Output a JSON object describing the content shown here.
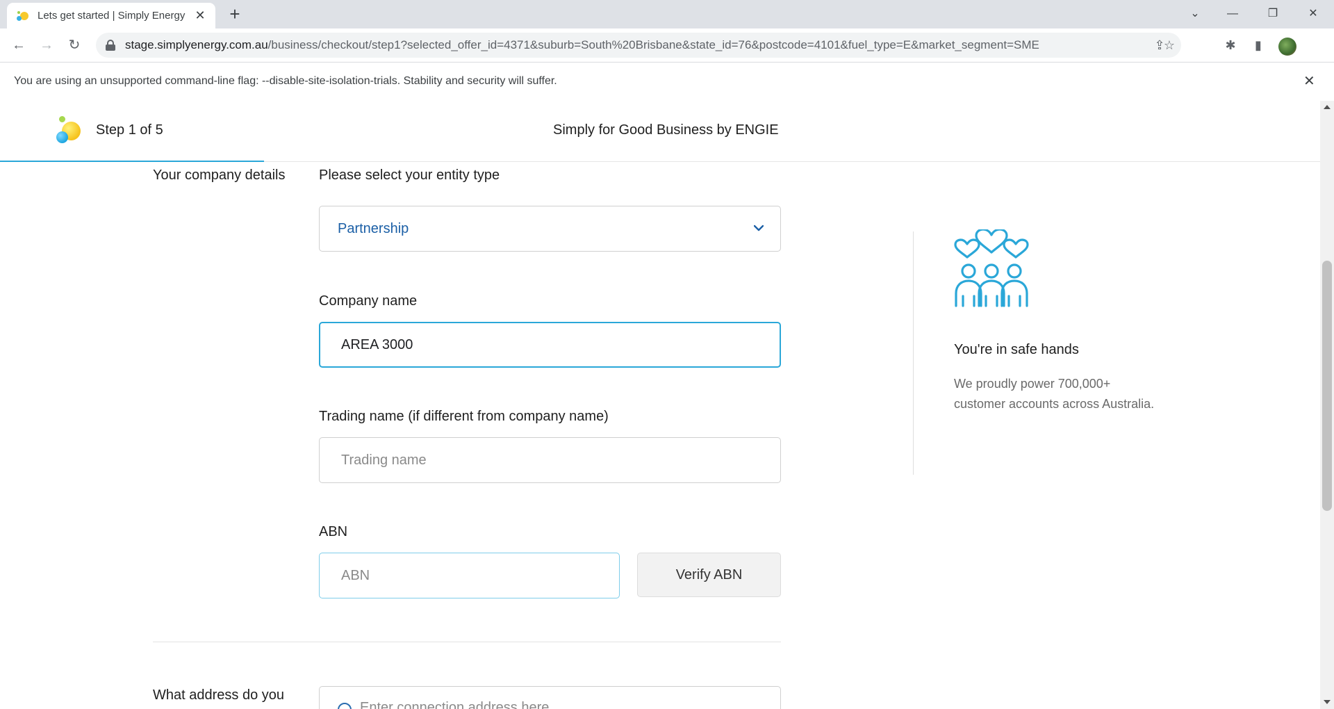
{
  "browser": {
    "tab_title": "Lets get started | Simply Energy",
    "url_host": "stage.simplyenergy.com.au",
    "url_path": "/business/checkout/step1?selected_offer_id=4371&suburb=South%20Brisbane&state_id=76&postcode=4101&fuel_type=E&market_segment=SME",
    "infobar_message": "You are using an unsupported command-line flag: --disable-site-isolation-trials. Stability and security will suffer."
  },
  "header": {
    "step": "Step 1 of 5",
    "brand": "Simply for Good Business by ENGIE",
    "progress_fraction": 0.2
  },
  "form": {
    "section_company": "Your company details",
    "entity_label": "Please select your entity type",
    "entity_value": "Partnership",
    "company_label": "Company name",
    "company_value": "AREA 3000",
    "trading_label": "Trading name (if different from company name)",
    "trading_placeholder": "Trading name",
    "abn_label": "ABN",
    "abn_placeholder": "ABN",
    "verify_label": "Verify ABN",
    "section_address": "What address do you",
    "address_placeholder": "Enter connection address here"
  },
  "aside": {
    "title": "You're in safe hands",
    "body": "We proudly power 700,000+ customer accounts across Australia."
  },
  "colors": {
    "accent": "#2aa7d8",
    "select_text": "#1b5fa6",
    "icon": "#2aa7d8"
  }
}
